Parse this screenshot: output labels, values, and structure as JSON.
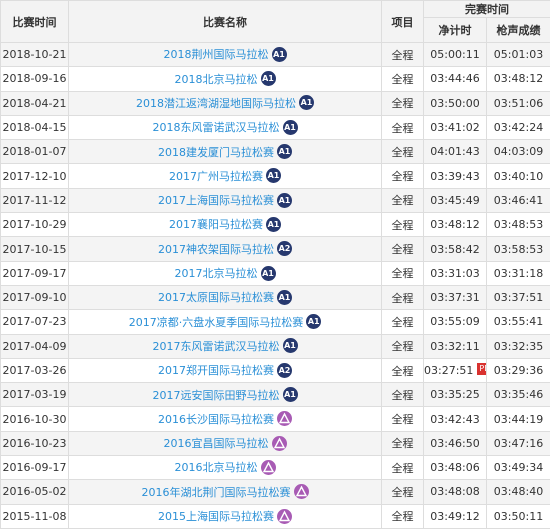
{
  "header": {
    "date": "比赛时间",
    "name": "比赛名称",
    "item": "项目",
    "finish": "完赛时间",
    "net": "净计时",
    "gun": "枪声成绩"
  },
  "rows": [
    {
      "date": "2018-10-21",
      "name": "2018荆州国际马拉松",
      "badge": "A1",
      "item": "全程",
      "net": "05:00:11",
      "gun": "05:01:03"
    },
    {
      "date": "2018-09-16",
      "name": "2018北京马拉松",
      "badge": "A1",
      "item": "全程",
      "net": "03:44:46",
      "gun": "03:48:12"
    },
    {
      "date": "2018-04-21",
      "name": "2018潜江返湾湖湿地国际马拉松",
      "badge": "A1",
      "item": "全程",
      "net": "03:50:00",
      "gun": "03:51:06"
    },
    {
      "date": "2018-04-15",
      "name": "2018东风雷诺武汉马拉松",
      "badge": "A1",
      "item": "全程",
      "net": "03:41:02",
      "gun": "03:42:24"
    },
    {
      "date": "2018-01-07",
      "name": "2018建发厦门马拉松赛",
      "badge": "A1",
      "item": "全程",
      "net": "04:01:43",
      "gun": "04:03:09"
    },
    {
      "date": "2017-12-10",
      "name": "2017广州马拉松赛",
      "badge": "A1",
      "item": "全程",
      "net": "03:39:43",
      "gun": "03:40:10"
    },
    {
      "date": "2017-11-12",
      "name": "2017上海国际马拉松赛",
      "badge": "A1",
      "item": "全程",
      "net": "03:45:49",
      "gun": "03:46:41"
    },
    {
      "date": "2017-10-29",
      "name": "2017襄阳马拉松赛",
      "badge": "A1",
      "item": "全程",
      "net": "03:48:12",
      "gun": "03:48:53"
    },
    {
      "date": "2017-10-15",
      "name": "2017神农架国际马拉松",
      "badge": "A2",
      "item": "全程",
      "net": "03:58:42",
      "gun": "03:58:53"
    },
    {
      "date": "2017-09-17",
      "name": "2017北京马拉松",
      "badge": "A1",
      "item": "全程",
      "net": "03:31:03",
      "gun": "03:31:18"
    },
    {
      "date": "2017-09-10",
      "name": "2017太原国际马拉松赛",
      "badge": "A1",
      "item": "全程",
      "net": "03:37:31",
      "gun": "03:37:51"
    },
    {
      "date": "2017-07-23",
      "name": "2017凉都·六盘水夏季国际马拉松赛",
      "badge": "A1",
      "item": "全程",
      "net": "03:55:09",
      "gun": "03:55:41"
    },
    {
      "date": "2017-04-09",
      "name": "2017东风雷诺武汉马拉松",
      "badge": "A1",
      "item": "全程",
      "net": "03:32:11",
      "gun": "03:32:35"
    },
    {
      "date": "2017-03-26",
      "name": "2017郑开国际马拉松赛",
      "badge": "A2",
      "item": "全程",
      "net": "03:27:51",
      "pb": "PB",
      "gun": "03:29:36"
    },
    {
      "date": "2017-03-19",
      "name": "2017远安国际田野马拉松",
      "badge": "A1",
      "item": "全程",
      "net": "03:35:25",
      "gun": "03:35:46"
    },
    {
      "date": "2016-10-30",
      "name": "2016长沙国际马拉松赛",
      "badge": "triangle",
      "item": "全程",
      "net": "03:42:43",
      "gun": "03:44:19"
    },
    {
      "date": "2016-10-23",
      "name": "2016宜昌国际马拉松",
      "badge": "triangle",
      "item": "全程",
      "net": "03:46:50",
      "gun": "03:47:16"
    },
    {
      "date": "2016-09-17",
      "name": "2016北京马拉松",
      "badge": "triangle",
      "item": "全程",
      "net": "03:48:06",
      "gun": "03:49:34"
    },
    {
      "date": "2016-05-02",
      "name": "2016年湖北荆门国际马拉松赛",
      "badge": "triangle",
      "item": "全程",
      "net": "03:48:08",
      "gun": "03:48:40"
    },
    {
      "date": "2015-11-08",
      "name": "2015上海国际马拉松赛",
      "badge": "triangle",
      "item": "全程",
      "net": "03:49:12",
      "gun": "03:50:11"
    }
  ]
}
